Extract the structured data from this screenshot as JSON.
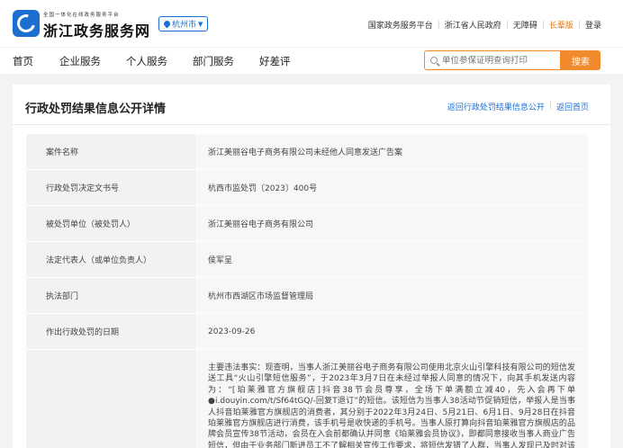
{
  "header": {
    "brand_sub": "全国一体化在线政务服务平台",
    "brand_title": "浙江政务服务网",
    "city": "杭州市",
    "links": [
      "国家政务服务平台",
      "浙江省人民政府",
      "无障碍",
      "长辈版",
      "登录"
    ]
  },
  "nav": {
    "items": [
      "首页",
      "企业服务",
      "个人服务",
      "部门服务",
      "好差评"
    ],
    "search_placeholder": "单位参保证明查询打印",
    "search_button": "搜索"
  },
  "page": {
    "title": "行政处罚结果信息公开详情",
    "back_link": "返回行政处罚结果信息公开",
    "home_link": "返回首页"
  },
  "details": [
    {
      "label": "案件名称",
      "value": "浙江美丽谷电子商务有限公司未经他人同意发送广告案"
    },
    {
      "label": "行政处罚决定文书号",
      "value": "杭西市监处罚〔2023〕400号"
    },
    {
      "label": "被处罚单位（被处罚人）",
      "value": "浙江美丽谷电子商务有限公司"
    },
    {
      "label": "法定代表人（或单位负责人）",
      "value": "侯军呈"
    },
    {
      "label": "执法部门",
      "value": "杭州市西湖区市场监督管理局"
    },
    {
      "label": "作出行政处罚的日期",
      "value": "2023-09-26"
    },
    {
      "label": "",
      "value": "主要违法事实：现查明，当事人浙江美丽谷电子商务有限公司使用北京火山引擎科技有限公司的短信发送工具“火山引擎短信服务”，于2023年3月7日在未经过举报人同意的情况下，向其手机发送内容为：“[珀莱雅官方旗舰店]抖音38节会员尊享，全场下单满额立减40，先入会再下单●i.douyin.com/t/Sf64tGQ/-回复T退订”的短信。该短信为当事人38活动节促销短信，举报人是当事人抖音珀莱雅官方旗舰店的消费者，其分别于2022年3月24日、5月21日、6月1日、9月28日在抖音珀莱雅官方旗舰店进行消费，该手机号是收快递的手机号。当事人原打算向抖音珀莱雅官方旗舰店的品牌会员宣传38节活动，会员在入会前都确认并同意《珀莱雅会员协议》，即都同意接收当事人商业广告短信，但由于业务部门新进员工不了解相关宣传工作要求，将短信发错了人群，当事人发现已及时对该部门进行培训教育，避免再次发生类似情况。当事人通过在“火山引擎"
    }
  ]
}
